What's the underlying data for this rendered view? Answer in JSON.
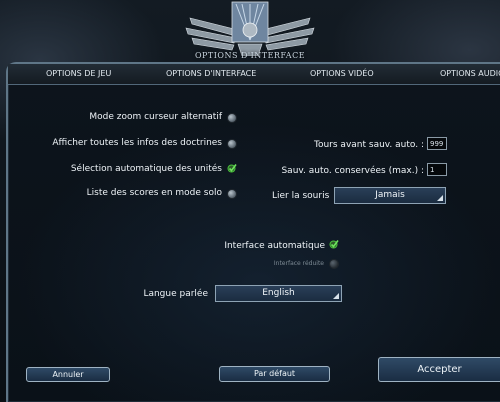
{
  "window": {
    "title": "OPTIONS D'INTERFACE"
  },
  "tabs": [
    {
      "label": "OPTIONS DE JEU"
    },
    {
      "label": "OPTIONS D'INTERFACE"
    },
    {
      "label": "OPTIONS VIDÉO"
    },
    {
      "label": "OPTIONS AUDIO"
    }
  ],
  "options": {
    "zoom_cursor": {
      "label": "Mode zoom curseur alternatif",
      "checked": false
    },
    "doctrines": {
      "label": "Afficher toutes les infos des doctrines",
      "checked": false
    },
    "auto_units": {
      "label": "Sélection automatique des unités",
      "checked": true
    },
    "solo_scores": {
      "label": "Liste des scores en mode solo",
      "checked": false
    },
    "auto_ui": {
      "label": "Interface automatique",
      "checked": true
    },
    "reduced_ui": {
      "label": "Interface réduite",
      "checked": false,
      "enabled": false
    }
  },
  "autosave": {
    "turns_label": "Tours avant sauv. auto. :",
    "turns_value": "999",
    "kept_label": "Sauv. auto. conservées (max.) :",
    "kept_value": "1"
  },
  "mouse": {
    "label": "Lier la souris",
    "value": "Jamais"
  },
  "language": {
    "label": "Langue parlée",
    "value": "English"
  },
  "buttons": {
    "cancel": "Annuler",
    "default": "Par défaut",
    "accept": "Accepter"
  },
  "colors": {
    "check_green": "#49c33b",
    "accent_border": "#9fb3c3",
    "button_blue": "#2f4a66"
  }
}
